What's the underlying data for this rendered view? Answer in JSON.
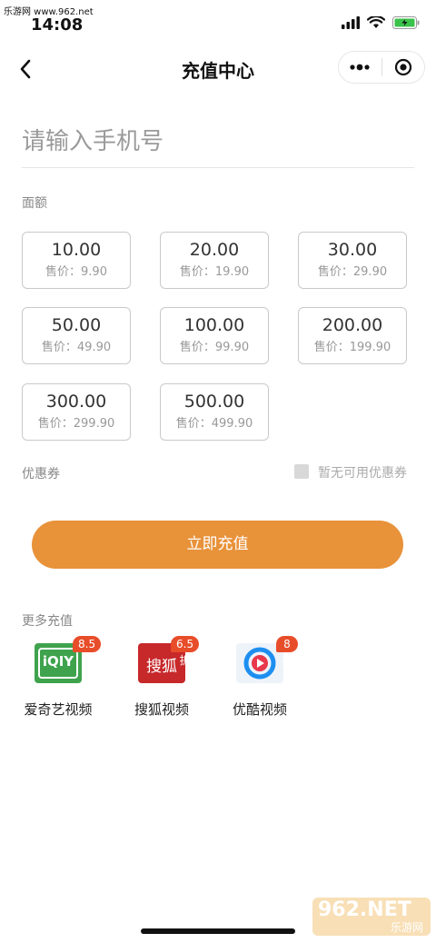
{
  "watermark": {
    "top_left": "乐游网 www.962.net",
    "brand": "962.NET",
    "brand_sub": "乐游网"
  },
  "status_bar": {
    "time": "14:08",
    "battery_color": "#3ac24a"
  },
  "nav": {
    "title": "充值中心",
    "more_icon": "more-dots-icon",
    "close_icon": "record-target-icon"
  },
  "phone": {
    "placeholder": "请输入手机号",
    "value": ""
  },
  "amount_section": {
    "label": "面额",
    "items": [
      {
        "value": "10.00",
        "price": "售价：9.90"
      },
      {
        "value": "20.00",
        "price": "售价：19.90"
      },
      {
        "value": "30.00",
        "price": "售价：29.90"
      },
      {
        "value": "50.00",
        "price": "售价：49.90"
      },
      {
        "value": "100.00",
        "price": "售价：99.90"
      },
      {
        "value": "200.00",
        "price": "售价：199.90"
      },
      {
        "value": "300.00",
        "price": "售价：299.90"
      },
      {
        "value": "500.00",
        "price": "售价：499.90"
      }
    ]
  },
  "coupon": {
    "label": "优惠券",
    "hint": "暂无可用优惠券"
  },
  "recharge_button": {
    "label": "立即充值",
    "color": "#e8923a"
  },
  "more_section": {
    "label": "更多充值",
    "apps": [
      {
        "name": "爱奇艺视频",
        "discount": "8.5折",
        "logo_text": "iQIY",
        "color": "#3fa34d"
      },
      {
        "name": "搜狐视频",
        "discount": "6.5折",
        "logo_text": "搜狐",
        "color": "#c7282a"
      },
      {
        "name": "优酷视频",
        "discount": "8折",
        "logo_text": "",
        "color": "#1e8ff0"
      }
    ]
  }
}
